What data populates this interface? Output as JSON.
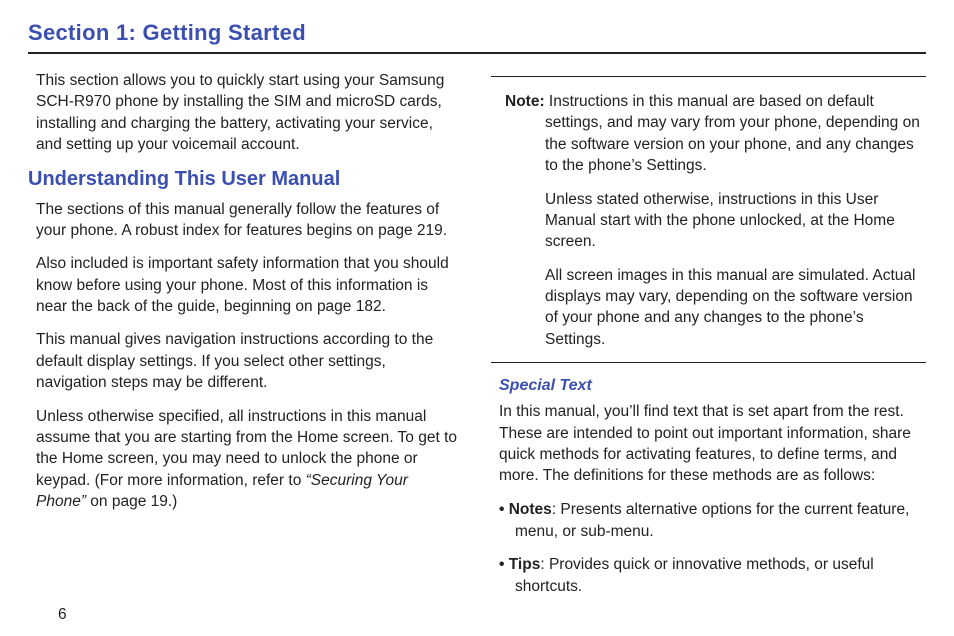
{
  "section_title": "Section 1: Getting Started",
  "page_number": "6",
  "col1": {
    "intro": "This section allows you to quickly start using your Samsung SCH-R970 phone by installing the SIM and microSD cards, installing and charging the battery, activating your service, and setting up your voicemail account.",
    "h_understanding": "Understanding This User Manual",
    "p1": "The sections of this manual generally follow the features of your phone. A robust index for features begins on page 219.",
    "p2": "Also included is important safety information that you should know before using your phone. Most of this information is near the back of the guide, beginning on page 182.",
    "p3": "This manual gives navigation instructions according to the default display settings. If you select other settings, navigation steps may be different.",
    "p4a": "Unless otherwise specified, all instructions in this manual assume that you are starting from the Home screen. To get to the Home screen, you may need to unlock the phone or keypad. (For more information, refer to ",
    "p4_ref": "“Securing Your Phone”",
    "p4b": " on page 19.)"
  },
  "col2": {
    "note_label": "Note:",
    "note1": " Instructions in this manual are based on default settings, and may vary from your phone, depending on the software version on your phone, and any changes to the phone’s Settings.",
    "note2": "Unless stated otherwise, instructions in this User Manual start with the phone unlocked, at the Home screen.",
    "note3": "All screen images in this manual are simulated. Actual displays may vary, depending on the software version of your phone and any changes to the phone’s Settings.",
    "h_special": "Special Text",
    "special_intro": "In this manual, you’ll find text that is set apart from the rest. These are intended to point out important information, share quick methods for activating features, to define terms, and more. The definitions for these methods are as follows:",
    "bullets": {
      "notes_label": "Notes",
      "notes_text": ": Presents alternative options for the current feature, menu, or sub-menu.",
      "tips_label": "Tips",
      "tips_text": ": Provides quick or innovative methods, or useful shortcuts."
    }
  }
}
